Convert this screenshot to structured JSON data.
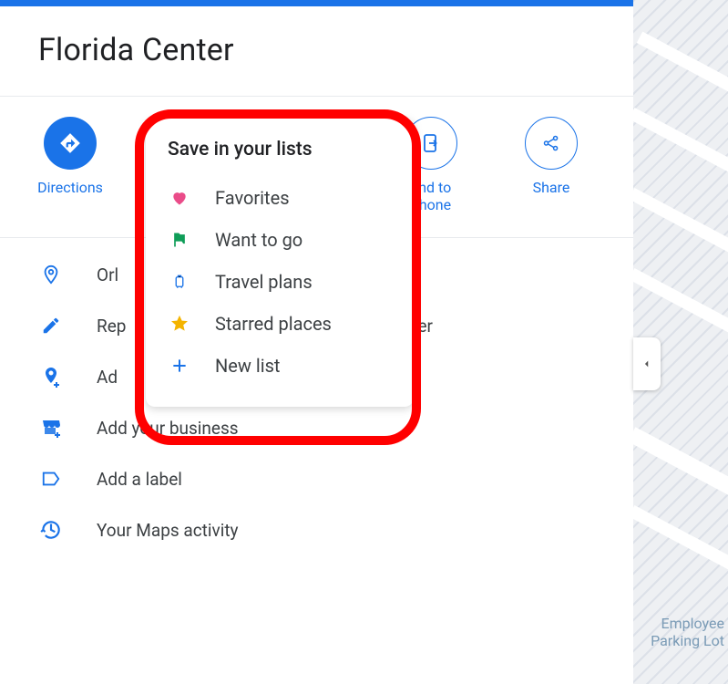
{
  "title": "Florida Center",
  "actions": {
    "directions": "Directions",
    "send": "Send to phone",
    "send_line1": "end to",
    "send_line2": "phone",
    "share": "Share"
  },
  "menu": {
    "location": "Orl",
    "report": "Rep",
    "report_suffix": "enter",
    "add_missing": "Ad",
    "add_business": "Add your business",
    "add_label": "Add a label",
    "activity": "Your Maps activity"
  },
  "popup": {
    "title": "Save in your lists",
    "favorites": "Favorites",
    "want": "Want to go",
    "travel": "Travel plans",
    "starred": "Starred places",
    "newlist": "New list"
  },
  "map": {
    "label_line1": "Employee",
    "label_line2": "Parking Lot"
  }
}
